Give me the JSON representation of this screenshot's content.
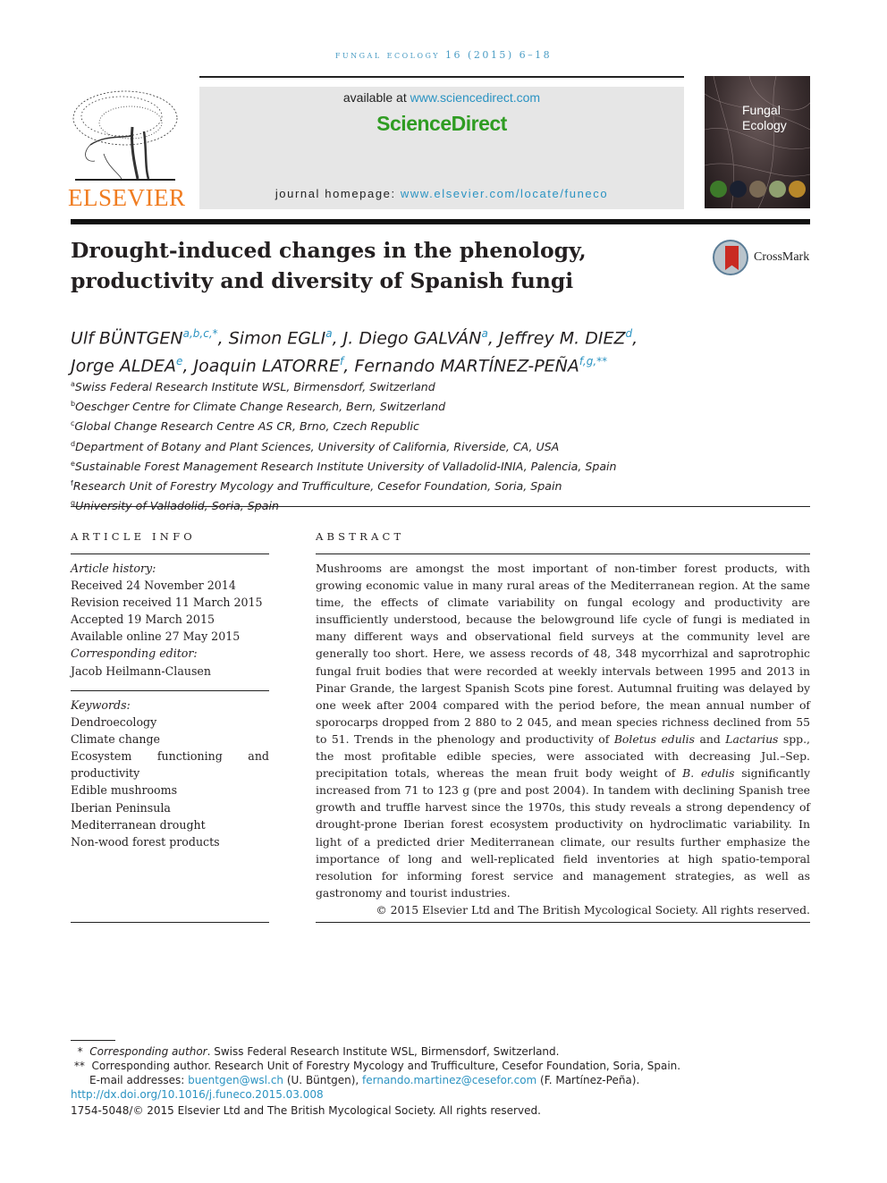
{
  "running_head": "fungal ecology 16 (2015) 6–18",
  "publisher": {
    "logo_word": "ELSEVIER",
    "logo_color": "#f07c20"
  },
  "sciencedirect": {
    "available_prefix": "available at ",
    "available_link": "www.sciencedirect.com",
    "brand": "ScienceDirect",
    "brand_color": "#2f9c22",
    "homepage_prefix": "journal homepage: ",
    "homepage_link": "www.elsevier.com/locate/funeco"
  },
  "cover": {
    "title_line1": "Fungal",
    "title_line2": "Ecology"
  },
  "article": {
    "title": "Drought-induced changes in the phenology, productivity and diversity of Spanish fungi",
    "crossmark_label": "CrossMark",
    "authors": [
      {
        "name": "Ulf BÜNTGEN",
        "sup": "a,b,c,*",
        "sep": ", "
      },
      {
        "name": "Simon EGLI",
        "sup": "a",
        "sep": ", "
      },
      {
        "name": "J. Diego GALVÁN",
        "sup": "a",
        "sep": ", "
      },
      {
        "name": "Jeffrey M. DIEZ",
        "sup": "d",
        "sep": ","
      },
      {
        "name": "Jorge ALDEA",
        "sup": "e",
        "sep": ", "
      },
      {
        "name": "Joaquin LATORRE",
        "sup": "f",
        "sep": ", "
      },
      {
        "name": "Fernando MARTÍNEZ-PEÑA",
        "sup": "f,g,**",
        "sep": ""
      }
    ],
    "affiliations": [
      {
        "key": "a",
        "text": "Swiss Federal Research Institute WSL, Birmensdorf, Switzerland"
      },
      {
        "key": "b",
        "text": "Oeschger Centre for Climate Change Research, Bern, Switzerland"
      },
      {
        "key": "c",
        "text": "Global Change Research Centre AS CR, Brno, Czech Republic"
      },
      {
        "key": "d",
        "text": "Department of Botany and Plant Sciences, University of California, Riverside, CA, USA"
      },
      {
        "key": "e",
        "text": "Sustainable Forest Management Research Institute University of Valladolid-INIA, Palencia, Spain"
      },
      {
        "key": "f",
        "text": "Research Unit of Forestry Mycology and Trufficulture, Cesefor Foundation, Soria, Spain"
      },
      {
        "key": "g",
        "text": "University of Valladolid, Soria, Spain"
      }
    ]
  },
  "article_info": {
    "heading": "ARTICLE INFO",
    "history_label": "Article history:",
    "received": "Received 24 November 2014",
    "revised": "Revision received 11 March 2015",
    "accepted": "Accepted 19 March 2015",
    "online": "Available online 27 May 2015",
    "editor_label": "Corresponding editor:",
    "editor": "Jacob Heilmann-Clausen",
    "keywords_label": "Keywords:",
    "keywords": [
      "Dendroecology",
      "Climate change",
      "Ecosystem functioning and productivity",
      "Edible mushrooms",
      "Iberian Peninsula",
      "Mediterranean drought",
      "Non-wood forest products"
    ]
  },
  "abstract": {
    "heading": "ABSTRACT",
    "part1": "Mushrooms are amongst the most important of non-timber forest products, with growing economic value in many rural areas of the Mediterranean region. At the same time, the effects of climate variability on fungal ecology and productivity are insufficiently understood, because the belowground life cycle of fungi is mediated in many different ways and observational field surveys at the community level are generally too short. Here, we assess records of 48, 348 mycorrhizal and saprotrophic fungal fruit bodies that were recorded at weekly intervals between 1995 and 2013 in Pinar Grande, the largest Spanish Scots pine forest. Autumnal fruiting was delayed by one week after 2004 compared with the period before, the mean annual number of sporocarps dropped from 2 880 to 2 045, and mean species richness declined from 55 to 51. Trends in the phenology and productivity of ",
    "it1": "Boletus edulis",
    "part2": " and ",
    "it2": "Lactarius",
    "part3": " spp., the most profitable edible species, were associated with decreasing Jul.–Sep. precipitation totals, whereas the mean fruit body weight of ",
    "it3": "B. edulis",
    "part4": " significantly increased from 71 to 123 g (pre and post 2004). In tandem with declining Spanish tree growth and truffle harvest since the 1970s, this study reveals a strong dependency of drought-prone Iberian forest ecosystem productivity on hydroclimatic variability. In light of a predicted drier Mediterranean climate, our results further emphasize the importance of long and well-replicated field inventories at high spatio-temporal resolution for informing forest service and management strategies, as well as gastronomy and tourist industries.",
    "copyright": "© 2015 Elsevier Ltd and The British Mycological Society. All rights reserved."
  },
  "footnotes": {
    "star1_mark": "*",
    "star1_label": "Corresponding author",
    "star1_text": ". Swiss Federal Research Institute WSL, Birmensdorf, Switzerland.",
    "star2_mark": "**",
    "star2_text": "Corresponding author. Research Unit of Forestry Mycology and Trufficulture, Cesefor Foundation, Soria, Spain.",
    "email_prefix": "E-mail addresses: ",
    "email1": "buentgen@wsl.ch",
    "email1_name": " (U. Büntgen), ",
    "email2": "fernando.martinez@cesefor.com",
    "email2_name": " (F. Martínez-Peña).",
    "doi": "http://dx.doi.org/10.1016/j.funeco.2015.03.008",
    "issn_line": "1754-5048/© 2015 Elsevier Ltd and The British Mycological Society. All rights reserved."
  }
}
